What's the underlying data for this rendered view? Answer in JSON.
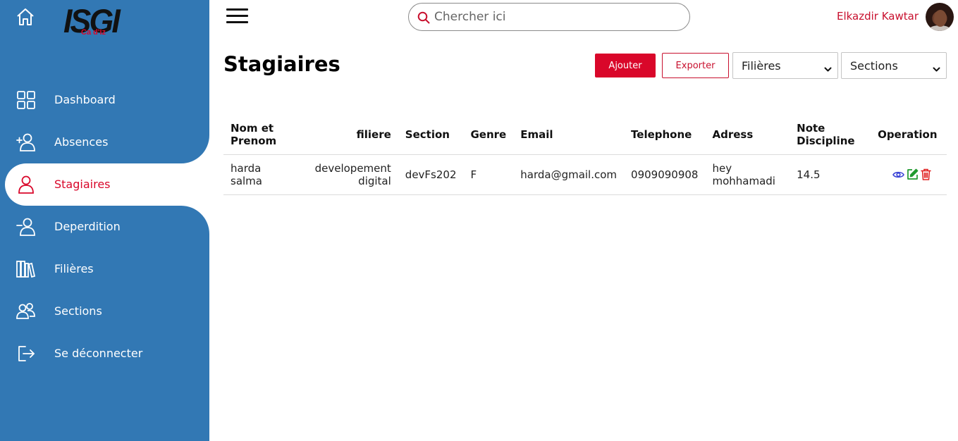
{
  "brand": {
    "logo_main": "ISGI",
    "logo_sub": "Ca d'Iz",
    "logo_color": "#d9072a"
  },
  "sidebar": {
    "background": "#3278b4",
    "items": [
      {
        "label": "Dashboard",
        "icon": "grid-icon"
      },
      {
        "label": "Absences",
        "icon": "user-plus-icon"
      },
      {
        "label": "Stagiaires",
        "icon": "user-icon",
        "active": true
      },
      {
        "label": "Deperdition",
        "icon": "user-minus-icon"
      },
      {
        "label": "Filières",
        "icon": "library-icon"
      },
      {
        "label": "Sections",
        "icon": "users-icon"
      },
      {
        "label": "Se déconnecter",
        "icon": "logout-icon"
      }
    ]
  },
  "topbar": {
    "search_placeholder": "Chercher ici",
    "user_name": "Elkazdir Kawtar"
  },
  "page": {
    "title": "Stagiaires",
    "add_label": "Ajouter",
    "export_label": "Exporter",
    "filter_filieres": "Filières",
    "filter_sections": "Sections"
  },
  "table": {
    "headers": [
      "Nom et Prenom",
      "filiere",
      "Section",
      "Genre",
      "Email",
      "Telephone",
      "Adress",
      "Note Discipline",
      "Operation"
    ],
    "rows": [
      {
        "nom": "harda salma",
        "filiere": "developement digital",
        "section": "devFs202",
        "genre": "F",
        "email": "harda@gmail.com",
        "telephone": "0909090908",
        "adress": "hey mohhamadi",
        "note": "14.5"
      }
    ]
  },
  "colors": {
    "accent": "#d9072a",
    "view": "#3b44d6",
    "edit": "#1f9a2e",
    "delete": "#e02020"
  }
}
